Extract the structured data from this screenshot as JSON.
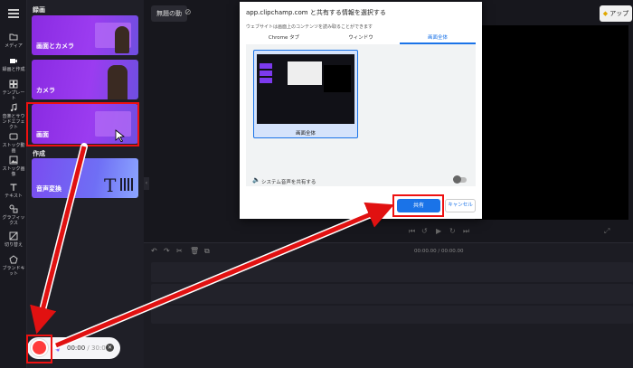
{
  "sidebar": {
    "items": [
      {
        "label": "メディア",
        "icon": "folder-icon"
      },
      {
        "label": "録画と作成",
        "icon": "video-camera-icon"
      },
      {
        "label": "テンプレート",
        "icon": "template-grid-icon"
      },
      {
        "label": "音楽とサウンドエフェクト",
        "icon": "music-note-icon"
      },
      {
        "label": "ストック動画",
        "icon": "film-icon"
      },
      {
        "label": "ストック画像",
        "icon": "image-icon"
      },
      {
        "label": "テキスト",
        "icon": "text-icon"
      },
      {
        "label": "グラフィックス",
        "icon": "shapes-icon"
      },
      {
        "label": "切り替え",
        "icon": "transition-icon"
      },
      {
        "label": "ブランドキット",
        "icon": "brand-kit-icon"
      }
    ]
  },
  "panel": {
    "record_heading": "録画",
    "create_heading": "作成",
    "cards": {
      "screen_camera": "画面とカメラ",
      "camera": "カメラ",
      "screen": "画面",
      "tts": "音声変換"
    }
  },
  "recorder": {
    "elapsed": "00:00",
    "separator": " / ",
    "total": "30:00"
  },
  "editor": {
    "project_title": "無題の動",
    "upgrade_label": "アップ",
    "timecode": "00:00.00 / 00:00.00"
  },
  "share_dialog": {
    "title": "app.clipchamp.com と共有する情報を選択する",
    "subtitle": "ウェブサイトは画面上のコンテンツを読み取ることができます",
    "tabs": [
      "Chrome タブ",
      "ウィンドウ",
      "画面全体"
    ],
    "active_tab": "画面全体",
    "thumbnail_label": "画面全体",
    "audio_label": "システム音声を共有する",
    "share_label": "共有",
    "cancel_label": "キャンセル"
  },
  "colors": {
    "annotation_red": "#e11111",
    "accent_blue": "#1a73e8",
    "record_red": "#ff3b3b",
    "card_purple": "#8a2be2"
  }
}
